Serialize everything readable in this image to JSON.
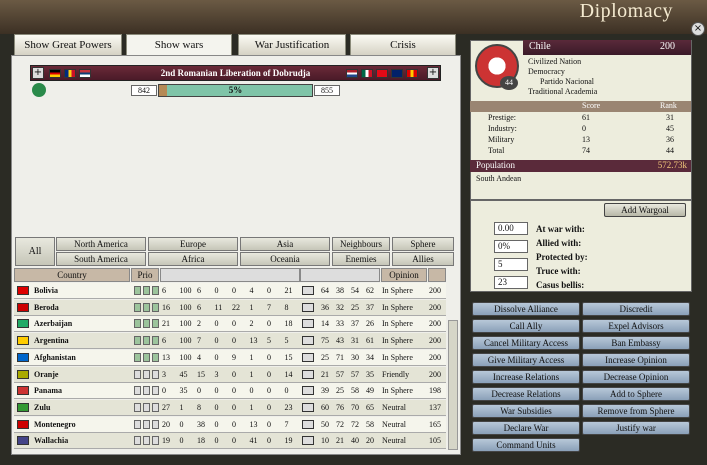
{
  "window": {
    "title": "Diplomacy",
    "close_label": "×"
  },
  "tabs": [
    "Show Great Powers",
    "Show wars",
    "War Justification",
    "Crisis"
  ],
  "war": {
    "name": "2nd Romanian Liberation of Dobrudja",
    "attacker_score": "842",
    "progress_label": "5%",
    "progress_fraction": 0.05,
    "defender_score": "855"
  },
  "filters": {
    "all": "All",
    "regions": [
      "North America",
      "Europe",
      "Asia",
      "South America",
      "Africa",
      "Oceania"
    ],
    "relations": [
      "Neighbours",
      "Sphere",
      "Enemies",
      "Allies"
    ]
  },
  "table": {
    "headers": [
      "Country",
      "Prio",
      "Opinion"
    ],
    "rows": [
      {
        "country": "Bolivia",
        "v": [
          "6",
          "100",
          "6",
          "0",
          "0",
          "4",
          "0",
          "21"
        ],
        "s": [
          "64",
          "38",
          "54",
          "62"
        ],
        "opinion": "In Sphere",
        "inf": "200"
      },
      {
        "country": "Beroda",
        "v": [
          "16",
          "100",
          "6",
          "11",
          "22",
          "1",
          "7",
          "8"
        ],
        "s": [
          "36",
          "32",
          "25",
          "37"
        ],
        "opinion": "In Sphere",
        "inf": "200"
      },
      {
        "country": "Azerbaijan",
        "v": [
          "21",
          "100",
          "2",
          "0",
          "0",
          "2",
          "0",
          "18"
        ],
        "s": [
          "14",
          "33",
          "37",
          "26"
        ],
        "opinion": "In Sphere",
        "inf": "200"
      },
      {
        "country": "Argentina",
        "v": [
          "6",
          "100",
          "7",
          "0",
          "0",
          "13",
          "5",
          "5"
        ],
        "s": [
          "75",
          "43",
          "31",
          "61"
        ],
        "opinion": "In Sphere",
        "inf": "200"
      },
      {
        "country": "Afghanistan",
        "v": [
          "13",
          "100",
          "4",
          "0",
          "9",
          "1",
          "0",
          "15"
        ],
        "s": [
          "25",
          "71",
          "30",
          "34"
        ],
        "opinion": "In Sphere",
        "inf": "200"
      },
      {
        "country": "Oranje",
        "v": [
          "3",
          "45",
          "15",
          "3",
          "0",
          "1",
          "0",
          "14"
        ],
        "s": [
          "21",
          "57",
          "57",
          "35"
        ],
        "opinion": "Friendly",
        "inf": "200"
      },
      {
        "country": "Panama",
        "v": [
          "0",
          "35",
          "0",
          "0",
          "0",
          "0",
          "0",
          "0"
        ],
        "s": [
          "39",
          "25",
          "58",
          "49"
        ],
        "opinion": "In Sphere",
        "inf": "198"
      },
      {
        "country": "Zulu",
        "v": [
          "27",
          "1",
          "8",
          "0",
          "0",
          "1",
          "0",
          "23"
        ],
        "s": [
          "60",
          "76",
          "70",
          "65"
        ],
        "opinion": "Neutral",
        "inf": "137"
      },
      {
        "country": "Montenegro",
        "v": [
          "20",
          "0",
          "38",
          "0",
          "0",
          "13",
          "0",
          "7"
        ],
        "s": [
          "50",
          "72",
          "72",
          "58"
        ],
        "opinion": "Neutral",
        "inf": "165"
      },
      {
        "country": "Wallachia",
        "v": [
          "19",
          "0",
          "18",
          "0",
          "0",
          "41",
          "0",
          "19"
        ],
        "s": [
          "10",
          "21",
          "40",
          "20"
        ],
        "opinion": "Neutral",
        "inf": "105"
      }
    ]
  },
  "country": {
    "name": "Chile",
    "influence": "200",
    "rank": "44",
    "type": "Civilized Nation",
    "government": "Democracy",
    "party": "Partido Nacional",
    "ideology": "Traditional Academia"
  },
  "stats": {
    "headers": [
      "Score",
      "Rank"
    ],
    "rows": [
      {
        "label": "Prestige:",
        "score": "61",
        "rank": "31"
      },
      {
        "label": "Industry:",
        "score": "0",
        "rank": "45"
      },
      {
        "label": "Military",
        "score": "13",
        "rank": "36"
      },
      {
        "label": "Total",
        "score": "74",
        "rank": "44"
      }
    ]
  },
  "population": {
    "label": "Population",
    "value": "572.73k",
    "culture": "South Andean"
  },
  "wargoal_button": "Add Wargoal",
  "relations": {
    "values": [
      "0.00",
      "0%",
      "5",
      "23"
    ],
    "labels": [
      "At war with:",
      "Allied with:",
      "Protected by:",
      "Truce with:",
      "Casus bellis:"
    ]
  },
  "actions": [
    [
      "Dissolve Alliance",
      "Discredit"
    ],
    [
      "Call Ally",
      "Expel Advisors"
    ],
    [
      "Cancel Military Access",
      "Ban Embassy"
    ],
    [
      "Give Military Access",
      "Increase Opinion"
    ],
    [
      "Increase Relations",
      "Decrease Opinion"
    ],
    [
      "Decrease Relations",
      "Add to Sphere"
    ],
    [
      "War Subsidies",
      "Remove from Sphere"
    ],
    [
      "Declare War",
      "Justify war"
    ],
    [
      "Command Units",
      ""
    ]
  ]
}
